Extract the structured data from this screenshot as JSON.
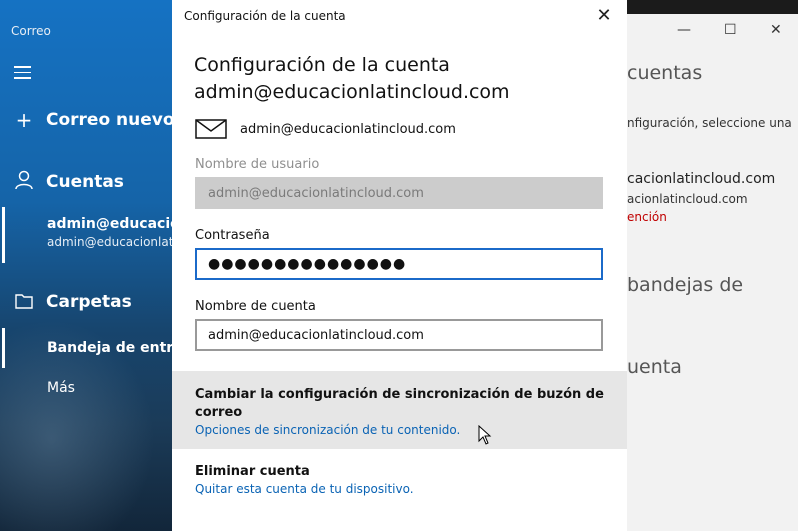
{
  "app": {
    "title": "Correo",
    "sidebar": {
      "new_mail": "Correo nuevo",
      "accounts": "Cuentas",
      "account_name": "admin@educacior",
      "account_email": "admin@educacionlat",
      "folders": "Carpetas",
      "inbox": "Bandeja de entrad",
      "more": "Más"
    }
  },
  "background_window": {
    "heading": "cuentas",
    "instruction": "nfiguración, seleccione una",
    "account_name": "cacionlatincloud.com",
    "account_email": "acionlatincloud.com",
    "warning": "ención",
    "section1": "bandejas de",
    "section2": "uenta"
  },
  "dialog": {
    "window_title": "Configuración de la cuenta",
    "heading_line1": "Configuración de la cuenta",
    "heading_line2": "admin@educacionlatincloud.com",
    "account_email": "admin@educacionlatincloud.com",
    "username_label": "Nombre de usuario",
    "username_value": "admin@educacionlatincloud.com",
    "password_label": "Contraseña",
    "password_value": "●●●●●●●●●●●●●●●",
    "account_name_label": "Nombre de cuenta",
    "account_name_value": "admin@educacionlatincloud.com",
    "sync_title": "Cambiar la configuración de sincronización de buzón de correo",
    "sync_subtitle": "Opciones de sincronización de tu contenido.",
    "delete_title": "Eliminar cuenta",
    "delete_subtitle": "Quitar esta cuenta de tu dispositivo."
  },
  "icons": {
    "close": "close-icon",
    "mail": "envelope-icon",
    "hamburger": "hamburger-menu-icon",
    "new_mail": "plus-icon",
    "accounts": "person-icon",
    "folders": "folder-icon"
  },
  "colors": {
    "accent": "#1b6ac9",
    "link": "#0a63b4",
    "sidebar": "#1572c3",
    "warning": "#c00000"
  }
}
